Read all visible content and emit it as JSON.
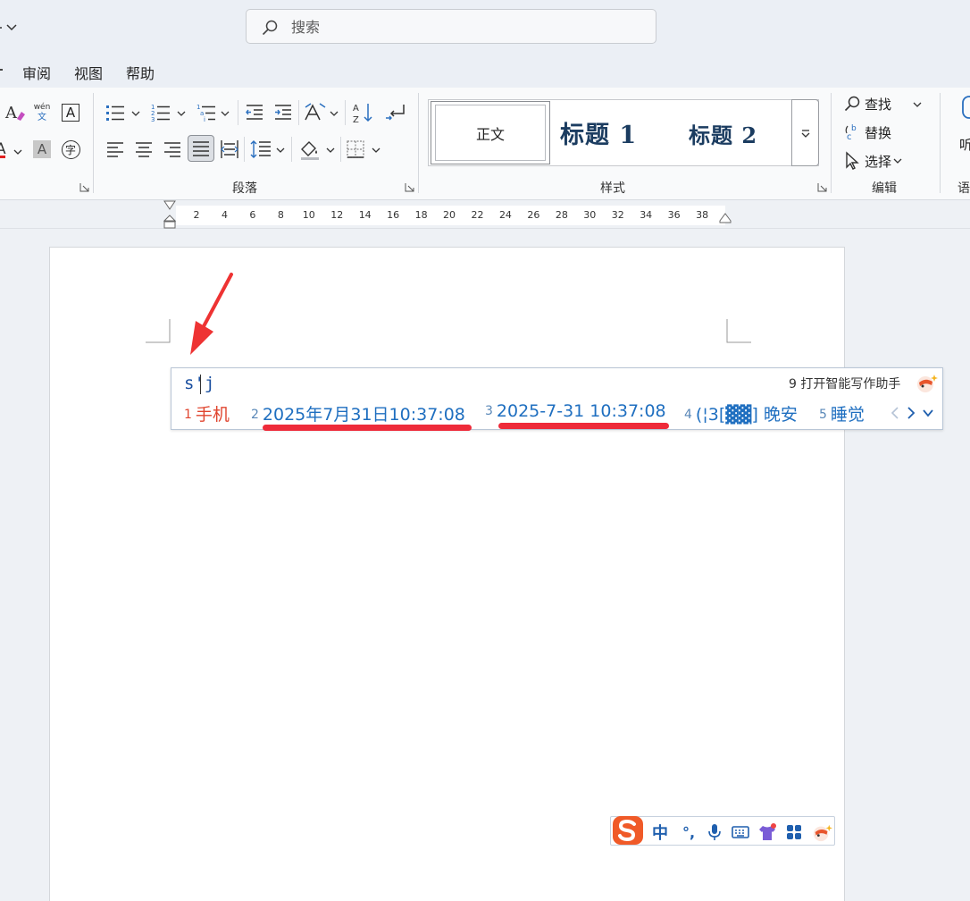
{
  "search": {
    "placeholder": "搜索"
  },
  "menu": {
    "tabs": [
      "审阅",
      "视图",
      "帮助"
    ]
  },
  "ribbon": {
    "groups": {
      "paragraph": "段落",
      "styles": "样式",
      "editing": "编辑",
      "voice_partial": "语"
    },
    "font_icons": {
      "phonetic_top": "wén",
      "phonetic_bottom": "文",
      "char_shading": "A",
      "enclose": "字",
      "border": "A"
    },
    "styles": {
      "normal": "正文",
      "heading1": "标题 1",
      "heading2": "标题 2"
    },
    "editing": {
      "find": "查找",
      "replace": "替换",
      "select": "选择"
    },
    "dictate_partial": "听"
  },
  "ruler": {
    "ticks": [
      "2",
      "4",
      "6",
      "8",
      "10",
      "12",
      "14",
      "16",
      "18",
      "20",
      "22",
      "24",
      "26",
      "28",
      "30",
      "32",
      "34",
      "36",
      "38"
    ]
  },
  "ime": {
    "composition": "s'j",
    "assistant": "9 打开智能写作助手",
    "candidates": [
      {
        "num": "1",
        "text": "手机"
      },
      {
        "num": "2",
        "text": "2025年7月31日10:37:08"
      },
      {
        "num": "3",
        "text": "2025-7-31 10:37:08"
      },
      {
        "num": "4",
        "text": "(¦3[▓▓] 晚安"
      },
      {
        "num": "5",
        "text": "睡觉"
      }
    ]
  },
  "ime_toolbar": {
    "mode": "中",
    "punct": "°,"
  },
  "colors": {
    "accent_red": "#ee2b3a",
    "candidate_blue": "#1f6fc0",
    "heading_navy": "#1b3c60"
  }
}
